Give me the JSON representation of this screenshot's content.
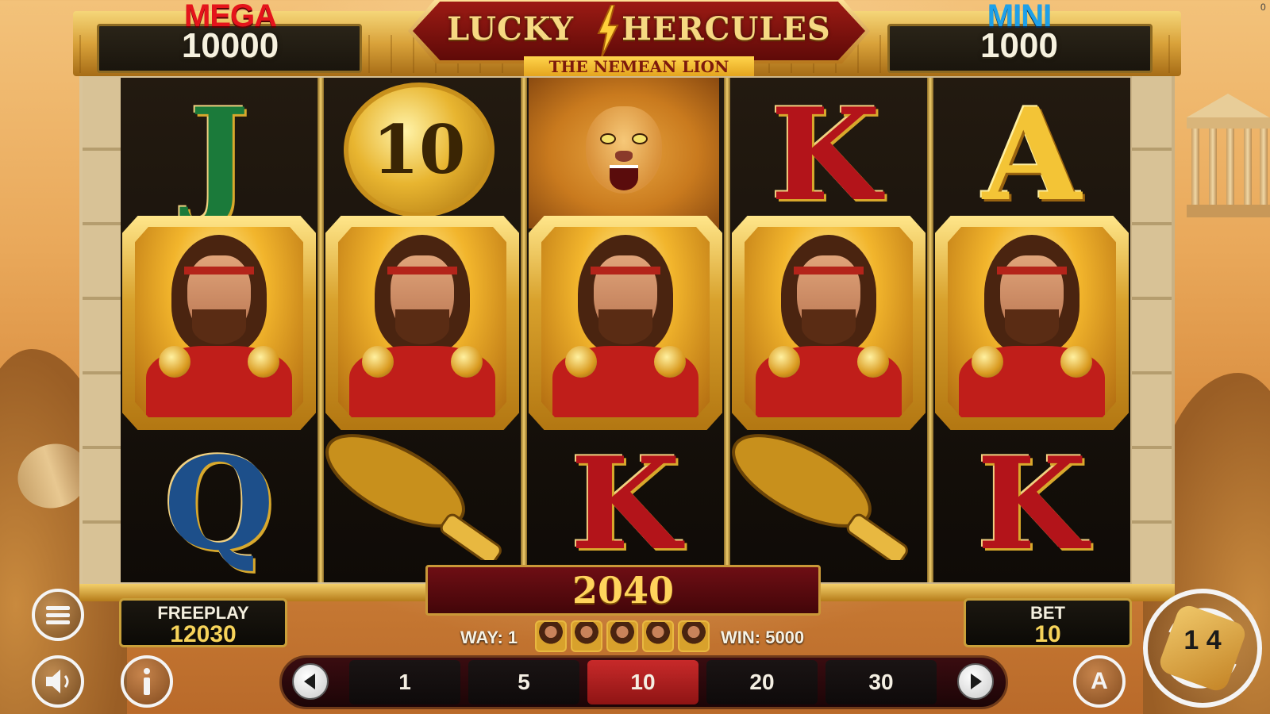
{
  "jackpots": {
    "mega": {
      "label": "MEGA",
      "value": "10000",
      "label_color": "#e5141b"
    },
    "mini": {
      "label": "MINI",
      "value": "1000",
      "label_color": "#1ea0e8"
    }
  },
  "logo": {
    "title_left": "LUCKY",
    "title_right": "HERCULES",
    "subtitle": "THE NEMEAN LION"
  },
  "reels": [
    {
      "top": "J",
      "middle": "hercules",
      "bottom": "Q"
    },
    {
      "top": "10",
      "middle": "hercules",
      "bottom": "club"
    },
    {
      "top": "lion",
      "middle": "hercules",
      "bottom": "K"
    },
    {
      "top": "K",
      "middle": "hercules",
      "bottom": "club"
    },
    {
      "top": "A",
      "middle": "hercules",
      "bottom": "K"
    }
  ],
  "win_amount": "2040",
  "freeplay": {
    "label": "FREEPLAY",
    "value": "12030"
  },
  "bet": {
    "label": "BET",
    "value": "10"
  },
  "way_line": {
    "way_label": "WAY: 1",
    "win_label": "WIN: 5000"
  },
  "bet_options": [
    "1",
    "5",
    "10",
    "20",
    "30"
  ],
  "bet_selected": "10",
  "icons": {
    "menu": "menu-icon",
    "sound": "speaker-icon",
    "info": "info-icon",
    "prev": "arrow-left-icon",
    "next": "arrow-right-icon",
    "auto": "autoplay-icon",
    "spin": "spin-icon"
  },
  "spin_glyphs": "1 4",
  "auto_glyph": "A",
  "version": "0",
  "colors": {
    "active_bet": "#c82a2a",
    "gold": "#d8a12c"
  }
}
